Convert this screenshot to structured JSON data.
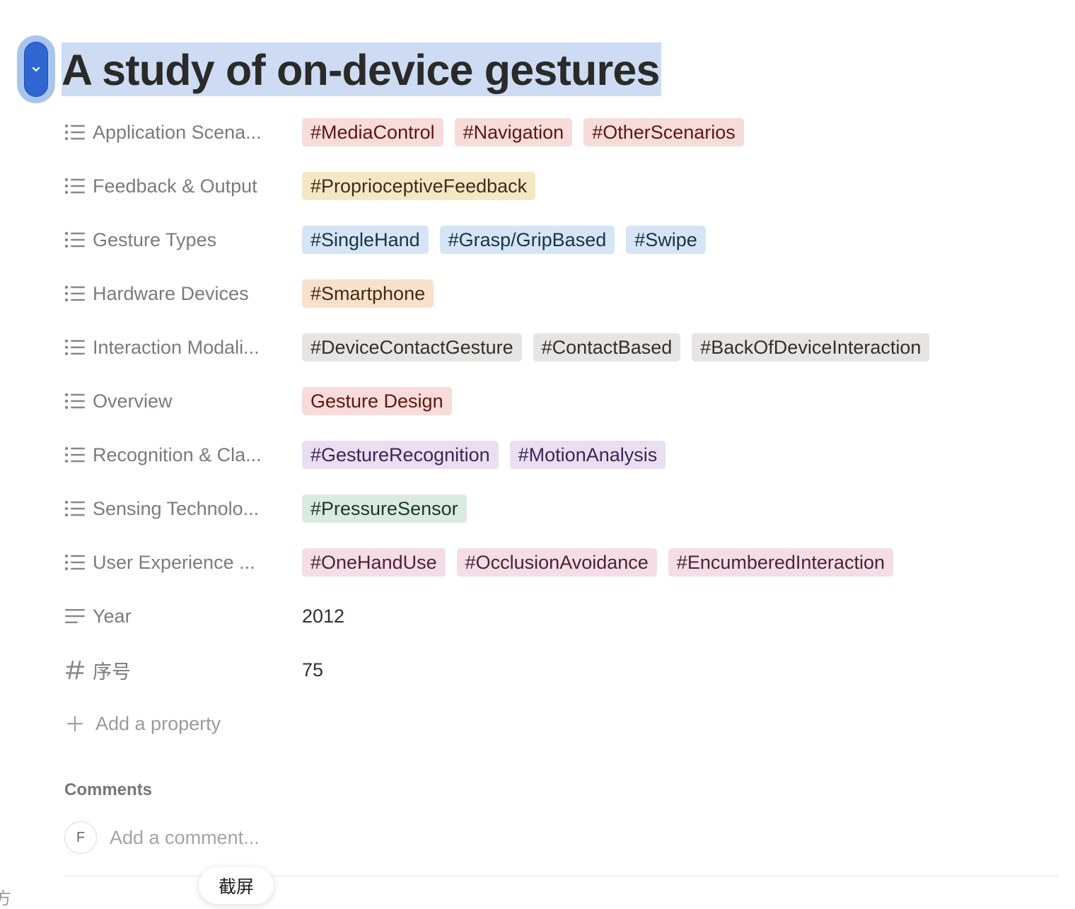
{
  "title": "A study of on-device gestures",
  "properties": [
    {
      "label": "Application Scena...",
      "icon": "list-icon",
      "tags": [
        {
          "text": "#MediaControl",
          "color": "red"
        },
        {
          "text": "#Navigation",
          "color": "red"
        },
        {
          "text": "#OtherScenarios",
          "color": "red"
        }
      ]
    },
    {
      "label": "Feedback & Output",
      "icon": "list-icon",
      "tags": [
        {
          "text": "#ProprioceptiveFeedback",
          "color": "yellow"
        }
      ]
    },
    {
      "label": "Gesture Types",
      "icon": "list-icon",
      "tags": [
        {
          "text": "#SingleHand",
          "color": "blue"
        },
        {
          "text": "#Grasp/GripBased",
          "color": "blue"
        },
        {
          "text": "#Swipe",
          "color": "blue"
        }
      ]
    },
    {
      "label": "Hardware Devices",
      "icon": "list-icon",
      "tags": [
        {
          "text": "#Smartphone",
          "color": "orange"
        }
      ]
    },
    {
      "label": "Interaction Modali...",
      "icon": "list-icon",
      "tags": [
        {
          "text": "#DeviceContactGesture",
          "color": "gray"
        },
        {
          "text": "#ContactBased",
          "color": "gray"
        },
        {
          "text": "#BackOfDeviceInteraction",
          "color": "gray"
        }
      ]
    },
    {
      "label": "Overview",
      "icon": "list-icon",
      "tags": [
        {
          "text": "Gesture Design",
          "color": "red"
        }
      ]
    },
    {
      "label": "Recognition & Cla...",
      "icon": "list-icon",
      "tags": [
        {
          "text": "#GestureRecognition",
          "color": "purple"
        },
        {
          "text": "#MotionAnalysis",
          "color": "purple"
        }
      ]
    },
    {
      "label": "Sensing Technolo...",
      "icon": "list-icon",
      "tags": [
        {
          "text": "#PressureSensor",
          "color": "green"
        }
      ]
    },
    {
      "label": "User Experience ...",
      "icon": "list-icon",
      "tags": [
        {
          "text": "#OneHandUse",
          "color": "pink"
        },
        {
          "text": "#OcclusionAvoidance",
          "color": "pink"
        },
        {
          "text": "#EncumberedInteraction",
          "color": "pink"
        }
      ]
    },
    {
      "label": "Year",
      "icon": "text-icon",
      "value": "2012"
    },
    {
      "label": "序号",
      "icon": "number-icon",
      "value": "75"
    }
  ],
  "add_property_label": "Add a property",
  "comments": {
    "title": "Comments",
    "avatar_initial": "F",
    "placeholder": "Add a comment..."
  },
  "tooltip": "截屏",
  "edge_glyph": "方",
  "colors": {
    "selection_highlight": "#cddcf3",
    "handle_blue": "#2f66d2",
    "label_gray": "#7d7b77"
  }
}
